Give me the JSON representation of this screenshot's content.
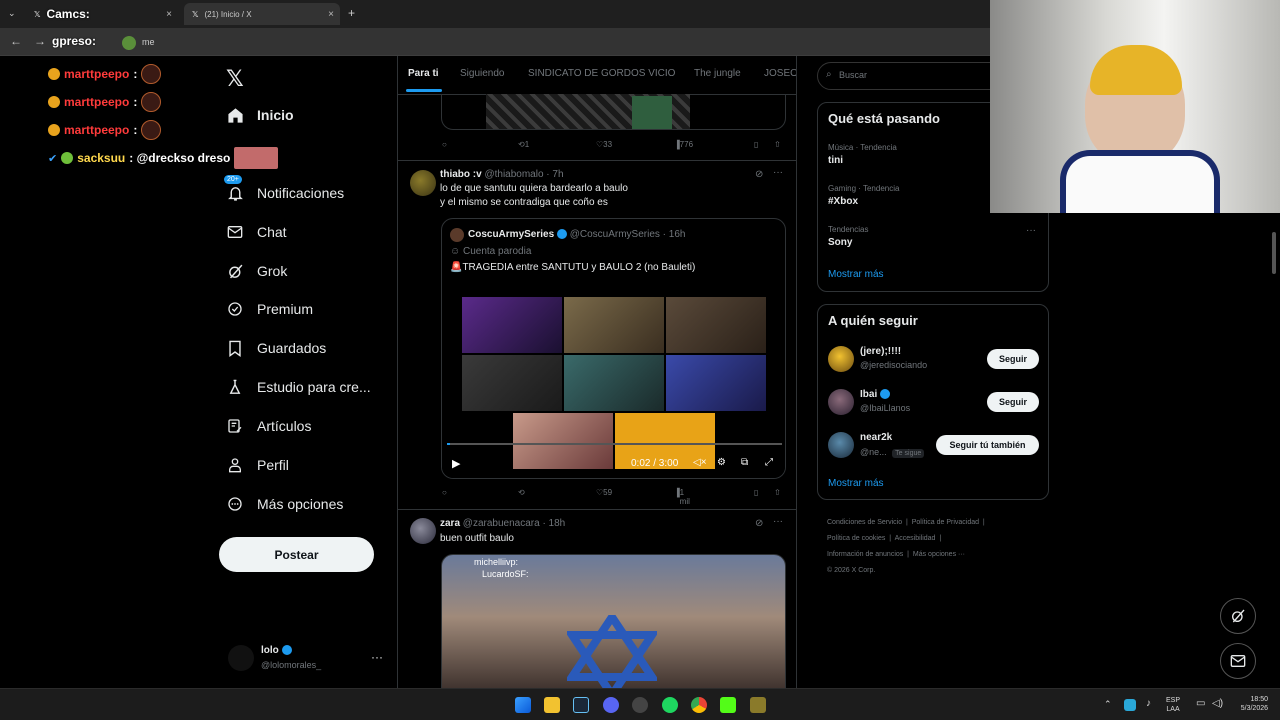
{
  "browser": {
    "tab1_label": "Camcs:",
    "tab2_label": "(21) Inicio / X",
    "address_text": "gpreso:",
    "address_url_tail": "me"
  },
  "overlay_chat": [
    {
      "user": "marttpeepo",
      "text": ":"
    },
    {
      "user": "marttpeepo",
      "text": ":"
    },
    {
      "user": "marttpeepo",
      "text": ":"
    },
    {
      "user": "sacksuu",
      "text": ": @drecksо dreso"
    }
  ],
  "nav": {
    "inicio": "Inicio",
    "notificaciones_badge": "20+",
    "notificaciones": "Notificaciones",
    "chat": "Chat",
    "grok": "Grok",
    "premium": "Premium",
    "guardados": "Guardados",
    "estudio": "Estudio para cre...",
    "articulos": "Artículos",
    "perfil": "Perfil",
    "mas": "Más opciones",
    "post": "Postear",
    "account_name": "lolo",
    "account_handle": "@lolomorales_"
  },
  "feed": {
    "tabs": [
      "Para ti",
      "Siguiendo",
      "SINDICATO DE GORDOS VICIO",
      "The jungle",
      "JOSEO"
    ],
    "post0_actions": {
      "retweets": "1",
      "likes": "33",
      "views": "776"
    },
    "post1": {
      "name": "thiabo :v",
      "handle": "@thiabomalo · 7h",
      "line1": "lo de que santutu quiera bardearlo a baulo",
      "line2": "y el mismo se contradiga que coño es",
      "quote": {
        "name": "CoscuArmySeries",
        "handle": "@CoscuArmySeries · 16h",
        "label": "Cuenta parodia",
        "text": "🚨TRAGEDIA entre SANTUTU y BAULO 2 (no Bauleti)"
      },
      "video_time": "0:02 / 3:00",
      "actions": {
        "likes": "59",
        "views": "1 mil"
      }
    },
    "post2": {
      "name": "zara",
      "handle": "@zarabuenacara · 18h",
      "text": "buen outfit baulo",
      "image_texts": [
        "michelliivp:",
        "LucardoSF:"
      ]
    }
  },
  "right": {
    "search_placeholder": "Buscar",
    "trending_title": "Qué está pasando",
    "trends": [
      {
        "category": "Música · Tendencia",
        "name": "tini"
      },
      {
        "category": "Gaming · Tendencia",
        "name": "#Xbox"
      },
      {
        "category": "Tendencias",
        "name": "Sony"
      }
    ],
    "show_more": "Mostrar más",
    "who_title": "A quién seguir",
    "who": [
      {
        "name": "(jere);!!!!",
        "handle": "@jeredisociando",
        "button": "Seguir"
      },
      {
        "name": "Ibai",
        "handle": "@IbaiLlanos",
        "button": "Seguir"
      },
      {
        "name": "near2k",
        "handle": "@ne...",
        "badge": "Te sigue",
        "button": "Seguir tú también"
      }
    ],
    "show_more2": "Mostrar más",
    "footer": [
      "Condiciones de Servicio",
      "Política de Privacidad",
      "Política de cookies",
      "Accesibilidad",
      "Información de anuncios",
      "Más opciones ···",
      "© 2026 X Corp."
    ]
  },
  "taskbar": {
    "lang1": "ESP",
    "lang2": "LAA",
    "time": "18:50",
    "date": "5/3/2026"
  },
  "colors": {
    "accent": "#1d9bf0",
    "background": "#000000",
    "border": "#2f3336"
  }
}
